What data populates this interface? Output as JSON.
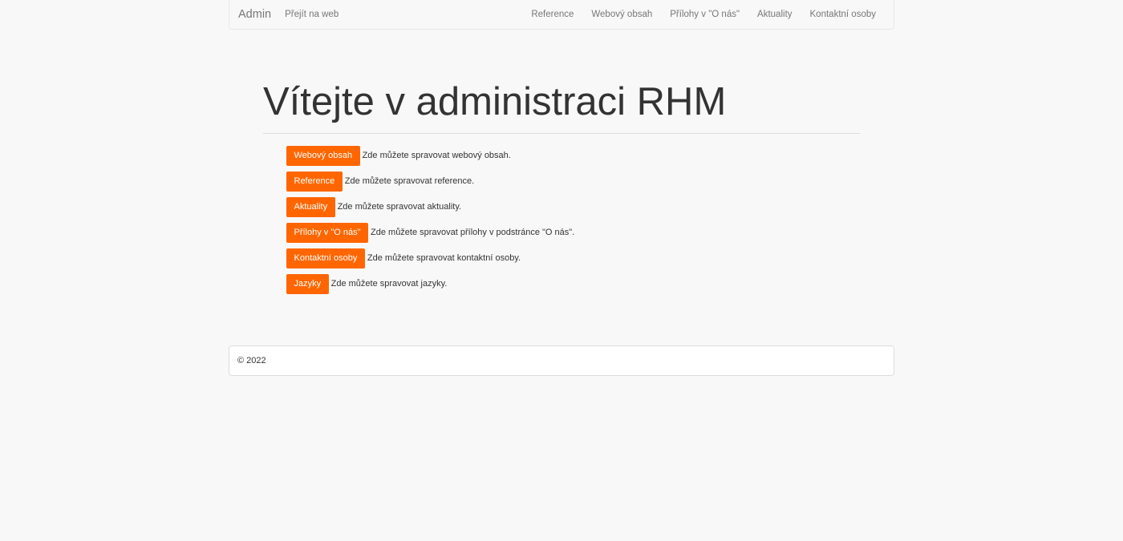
{
  "navbar": {
    "brand": "Admin",
    "left_links": [
      {
        "label": "Přejít na web"
      }
    ],
    "right_links": [
      {
        "label": "Reference"
      },
      {
        "label": "Webový obsah"
      },
      {
        "label": "Přílohy v \"O nás\""
      },
      {
        "label": "Aktuality"
      },
      {
        "label": "Kontaktní osoby"
      }
    ]
  },
  "main": {
    "title": "Vítejte v administraci RHM",
    "items": [
      {
        "button": "Webový obsah",
        "description": "Zde můžete spravovat webový obsah."
      },
      {
        "button": "Reference",
        "description": "Zde můžete spravovat reference."
      },
      {
        "button": "Aktuality",
        "description": "Zde můžete spravovat aktuality."
      },
      {
        "button": "Přílohy v \"O nás\"",
        "description": "Zde můžete spravovat přílohy v podstránce \"O nás\"."
      },
      {
        "button": "Kontaktní osoby",
        "description": "Zde můžete spravovat kontaktní osoby."
      },
      {
        "button": "Jazyky",
        "description": "Zde můžete spravovat jazyky."
      }
    ]
  },
  "footer": {
    "copyright": "© 2022"
  },
  "colors": {
    "accent": "#ff6600",
    "background": "#f8f8f8",
    "nav_text": "#777777",
    "text": "#333333"
  }
}
